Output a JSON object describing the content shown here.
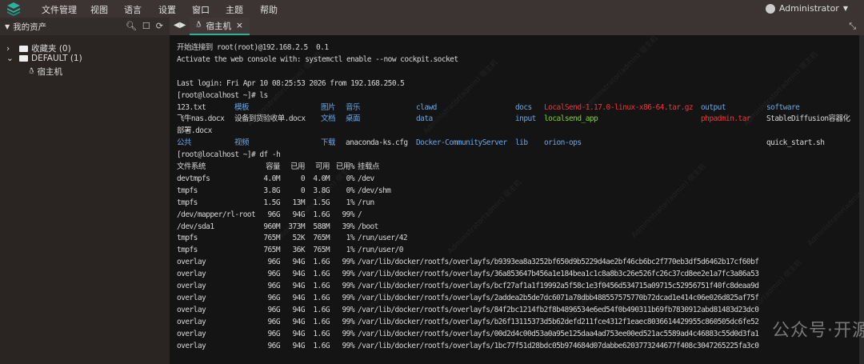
{
  "menubar": {
    "items": [
      "文件管理",
      "视图",
      "语言",
      "设置",
      "窗口",
      "主题",
      "帮助"
    ],
    "user": "Administrator"
  },
  "sidebar": {
    "title": "我的资产",
    "favorites": "收藏夹 (0)",
    "default": "DEFAULT (1)",
    "host": "宿主机"
  },
  "tab": {
    "label": "宿主机",
    "close": "×"
  },
  "terminal": {
    "intro": [
      "开始连接到 root(root)@192.168.2.5  0.1",
      "Activate the web console with: systemctl enable --now cockpit.socket",
      "",
      "Last login: Fri Apr 10 08:25:53 2026 from 192.168.250.5",
      "[root@localhost ~]# ls"
    ],
    "ls_rows": [
      [
        [
          "123.txt",
          ""
        ],
        [
          "模板",
          "blue"
        ],
        [
          "图片",
          "blue"
        ],
        [
          "音乐",
          "blue"
        ],
        [
          "clawd",
          "blue"
        ],
        [
          "docs",
          "blue"
        ],
        [
          "LocalSend-1.17.0-linux-x86-64.tar.gz",
          "red"
        ],
        [
          "output",
          "blue"
        ],
        [
          "software",
          "blue"
        ]
      ],
      [
        [
          "飞牛nas.docx",
          ""
        ],
        [
          "设备到货验收单.docx",
          ""
        ],
        [
          "文档",
          "blue"
        ],
        [
          "桌面",
          "blue"
        ],
        [
          "data",
          "blue"
        ],
        [
          "input",
          "blue"
        ],
        [
          "localsend_app",
          "green"
        ],
        [
          "phpadmin.tar",
          "red"
        ],
        [
          "StableDiffusion容器化",
          ""
        ]
      ],
      [
        [
          "部署.docx",
          ""
        ]
      ],
      [
        [
          "公共",
          "blue"
        ],
        [
          "视频",
          "blue"
        ],
        [
          "下载",
          "blue"
        ],
        [
          "anaconda-ks.cfg",
          ""
        ],
        [
          "Docker-CommunityServer",
          "blue"
        ],
        [
          "lib",
          "blue"
        ],
        [
          "orion-ops",
          "blue"
        ],
        [
          "",
          ""
        ],
        [
          "quick_start.sh",
          ""
        ]
      ]
    ],
    "df_cmd": "[root@localhost ~]# df -h",
    "df_header": [
      "文件系统",
      "容量",
      "已用",
      "可用",
      "已用%",
      "挂载点"
    ],
    "df_rows": [
      [
        "devtmpfs",
        "4.0M",
        "0",
        "4.0M",
        "0%",
        "/dev"
      ],
      [
        "tmpfs",
        "3.8G",
        "0",
        "3.8G",
        "0%",
        "/dev/shm"
      ],
      [
        "tmpfs",
        "1.5G",
        "13M",
        "1.5G",
        "1%",
        "/run"
      ],
      [
        "/dev/mapper/rl-root",
        "96G",
        "94G",
        "1.6G",
        "99%",
        "/"
      ],
      [
        "/dev/sda1",
        "960M",
        "373M",
        "588M",
        "39%",
        "/boot"
      ],
      [
        "tmpfs",
        "765M",
        "52K",
        "765M",
        "1%",
        "/run/user/42"
      ],
      [
        "tmpfs",
        "765M",
        "36K",
        "765M",
        "1%",
        "/run/user/0"
      ],
      [
        "overlay",
        "96G",
        "94G",
        "1.6G",
        "99%",
        "/var/lib/docker/rootfs/overlayfs/b9393ea8a3252bf650d9b5229d4ae2bf46cb6bc2f770eb3df5d6462b17cf60bf"
      ],
      [
        "overlay",
        "96G",
        "94G",
        "1.6G",
        "99%",
        "/var/lib/docker/rootfs/overlayfs/36a853647b456a1e184bea1c1c8a8b3c26e526fc26c37cd8ee2e1a7fc3a86a53"
      ],
      [
        "overlay",
        "96G",
        "94G",
        "1.6G",
        "99%",
        "/var/lib/docker/rootfs/overlayfs/bcf27af1a1f19992a5f58c1e3f0456d534715a09715c52956751f40fc8deaa9d"
      ],
      [
        "overlay",
        "96G",
        "94G",
        "1.6G",
        "99%",
        "/var/lib/docker/rootfs/overlayfs/2addea2b5de7dc6071a78dbb488557575770b72dcad1e414c06e026d825af75f"
      ],
      [
        "overlay",
        "96G",
        "94G",
        "1.6G",
        "99%",
        "/var/lib/docker/rootfs/overlayfs/84f2bc1214fb2f8b4896534e6ed54f0b490311b69fb7830912abd81483d23dc0"
      ],
      [
        "overlay",
        "96G",
        "94G",
        "1.6G",
        "99%",
        "/var/lib/docker/rootfs/overlayfs/b26f13115373d5b62defd211fce4312f1eaec8036614429955c860505dc6fe52"
      ],
      [
        "overlay",
        "96G",
        "94G",
        "1.6G",
        "99%",
        "/var/lib/docker/rootfs/overlayfs/00d2d4c00d53a0a95e125daa4ad753ee00ed521ac5589ad4c46883c55d0d3fa1"
      ],
      [
        "overlay",
        "96G",
        "94G",
        "1.6G",
        "99%",
        "/var/lib/docker/rootfs/overlayfs/1bc77f51d28bdc05b974684d07dabbe6203773244677f408c3047265225fa3c0"
      ]
    ]
  },
  "watermark": {
    "text": "Administrator(admin) 宿主机",
    "wechat": "公众号·开源未来"
  },
  "colors": {
    "accent": "#2bb39a",
    "dir": "#6aa8e8",
    "archive": "#e8383a",
    "exec": "#7ed321"
  }
}
